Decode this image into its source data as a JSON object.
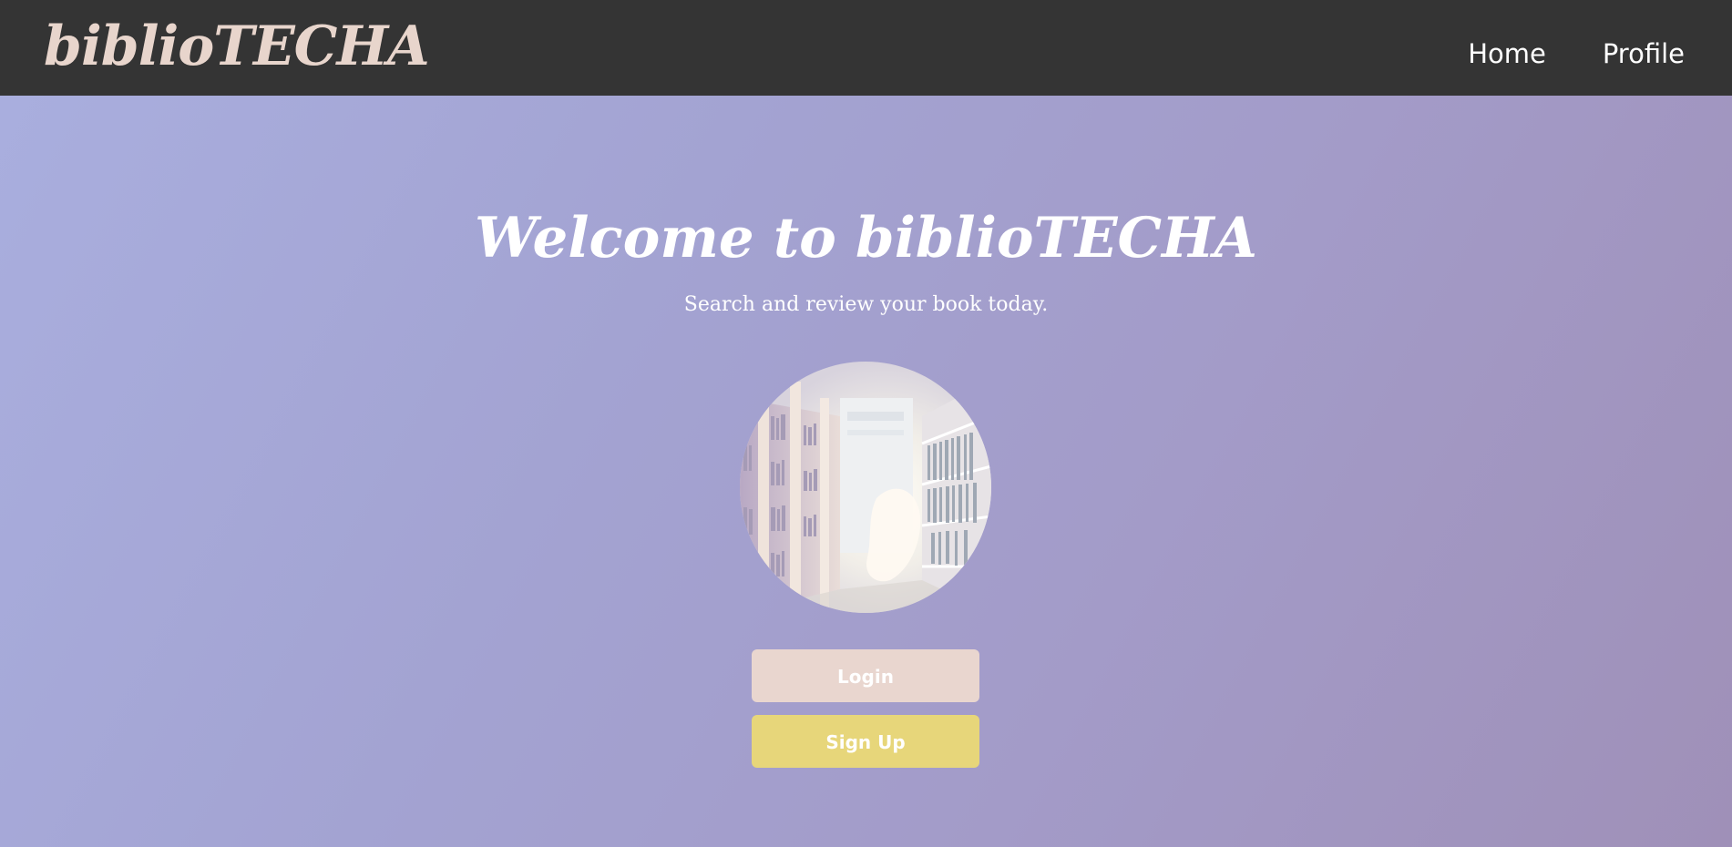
{
  "navbar": {
    "brand": "biblioTECHA",
    "links": [
      {
        "label": "Home"
      },
      {
        "label": "Profile"
      }
    ]
  },
  "hero": {
    "title": "Welcome to biblioTECHA",
    "subtitle": "Search and review your book today.",
    "image_icon": "library-bookshelves-image"
  },
  "actions": {
    "login_label": "Login",
    "signup_label": "Sign Up"
  },
  "colors": {
    "navbar_bg": "#343434",
    "brand": "#e8d5cc",
    "login_button": "#e9d6cf",
    "signup_button": "#e7d67a",
    "background_start": "#a9aede",
    "background_end": "#9f90b8"
  }
}
